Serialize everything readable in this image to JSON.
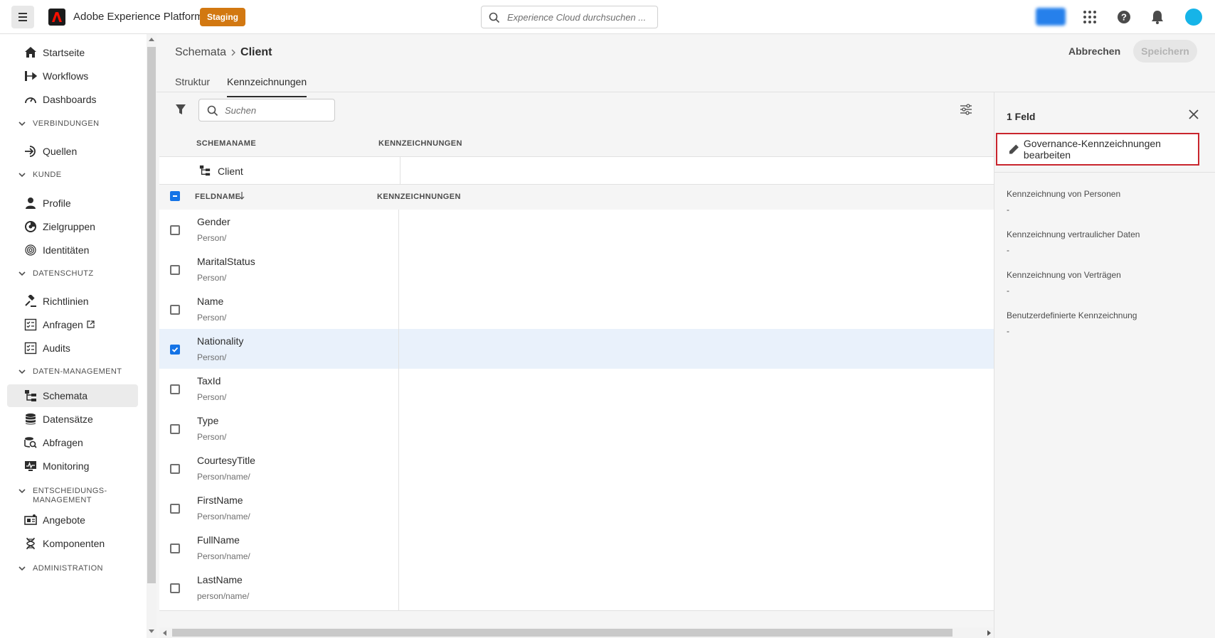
{
  "header": {
    "app_title": "Adobe Experience Platform",
    "env_badge": "Staging",
    "search_placeholder": "Experience Cloud durchsuchen ...",
    "blurred_button": "Prod"
  },
  "sidebar": {
    "items": [
      {
        "label": "Startseite",
        "icon": "home-icon"
      },
      {
        "label": "Workflows",
        "icon": "workflow-icon"
      },
      {
        "label": "Dashboards",
        "icon": "dashboard-icon"
      },
      {
        "label": "Quellen",
        "icon": "sources-icon"
      },
      {
        "label": "Profile",
        "icon": "person-icon"
      },
      {
        "label": "Zielgruppen",
        "icon": "segments-icon"
      },
      {
        "label": "Identitäten",
        "icon": "fingerprint-icon"
      },
      {
        "label": "Richtlinien",
        "icon": "gavel-icon"
      },
      {
        "label": "Anfragen",
        "icon": "checklist-icon"
      },
      {
        "label": "Audits",
        "icon": "checklist-icon"
      },
      {
        "label": "Schemata",
        "icon": "schema-icon"
      },
      {
        "label": "Datensätze",
        "icon": "database-icon"
      },
      {
        "label": "Abfragen",
        "icon": "query-icon"
      },
      {
        "label": "Monitoring",
        "icon": "monitor-icon"
      },
      {
        "label": "Angebote",
        "icon": "offer-icon"
      },
      {
        "label": "Komponenten",
        "icon": "dna-icon"
      }
    ],
    "sections": {
      "verbindungen": "VERBINDUNGEN",
      "kunde": "KUNDE",
      "datenschutz": "DATENSCHUTZ",
      "daten_management": "DATEN-MANAGEMENT",
      "entscheidung_1": "ENTSCHEIDUNGS-",
      "entscheidung_2": "MANAGEMENT",
      "administration": "ADMINISTRATION"
    },
    "active": "Schemata"
  },
  "main": {
    "breadcrumb_parent": "Schemata",
    "breadcrumb_current": "Client",
    "cancel_label": "Abbrechen",
    "save_label": "Speichern",
    "tabs": [
      {
        "label": "Struktur"
      },
      {
        "label": "Kennzeichnungen"
      }
    ],
    "table_search_placeholder": "Suchen",
    "schema_header": {
      "col1": "SCHEMANAME",
      "col2": "KENNZEICHNUNGEN"
    },
    "schema_name": "Client",
    "field_header": {
      "col1": "FELDNAME",
      "col2": "KENNZEICHNUNGEN"
    },
    "rows": [
      {
        "name": "Gender",
        "path": "Person/",
        "checked": false
      },
      {
        "name": "MaritalStatus",
        "path": "Person/",
        "checked": false
      },
      {
        "name": "Name",
        "path": "Person/",
        "checked": false
      },
      {
        "name": "Nationality",
        "path": "Person/",
        "checked": true
      },
      {
        "name": "TaxId",
        "path": "Person/",
        "checked": false
      },
      {
        "name": "Type",
        "path": "Person/",
        "checked": false
      },
      {
        "name": "CourtesyTitle",
        "path": "Person/name/",
        "checked": false
      },
      {
        "name": "FirstName",
        "path": "Person/name/",
        "checked": false
      },
      {
        "name": "FullName",
        "path": "Person/name/",
        "checked": false
      },
      {
        "name": "LastName",
        "path": "person/name/",
        "checked": false
      }
    ]
  },
  "panel": {
    "title": "1 Feld",
    "edit_label": "Governance-Kennzeichnungen bearbeiten",
    "fields": [
      {
        "label": "Kennzeichnung von Personen",
        "value": "-"
      },
      {
        "label": "Kennzeichnung vertraulicher Daten",
        "value": "-"
      },
      {
        "label": "Kennzeichnung von Verträgen",
        "value": "-"
      },
      {
        "label": "Benutzerdefinierte Kennzeichnung",
        "value": "-"
      }
    ]
  },
  "colors": {
    "accent": "#1473e6",
    "env_badge": "#d27811",
    "highlight_border": "#c9252d",
    "selected_row": "#e9f1fb"
  }
}
